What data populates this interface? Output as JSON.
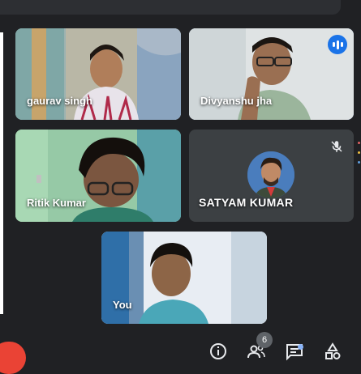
{
  "participants": [
    {
      "name": "gaurav singh"
    },
    {
      "name": "Divyanshu jha"
    },
    {
      "name": "Ritik Kumar"
    },
    {
      "name": "SATYAM KUMAR"
    },
    {
      "name": "You"
    }
  ],
  "controls": {
    "people_count": "6"
  },
  "colors": {
    "background": "#202124",
    "tile_empty": "#3c4043",
    "active_speaker": "#8ab4f8",
    "speaking_badge": "#1a73e8",
    "hangup": "#ea4335"
  }
}
